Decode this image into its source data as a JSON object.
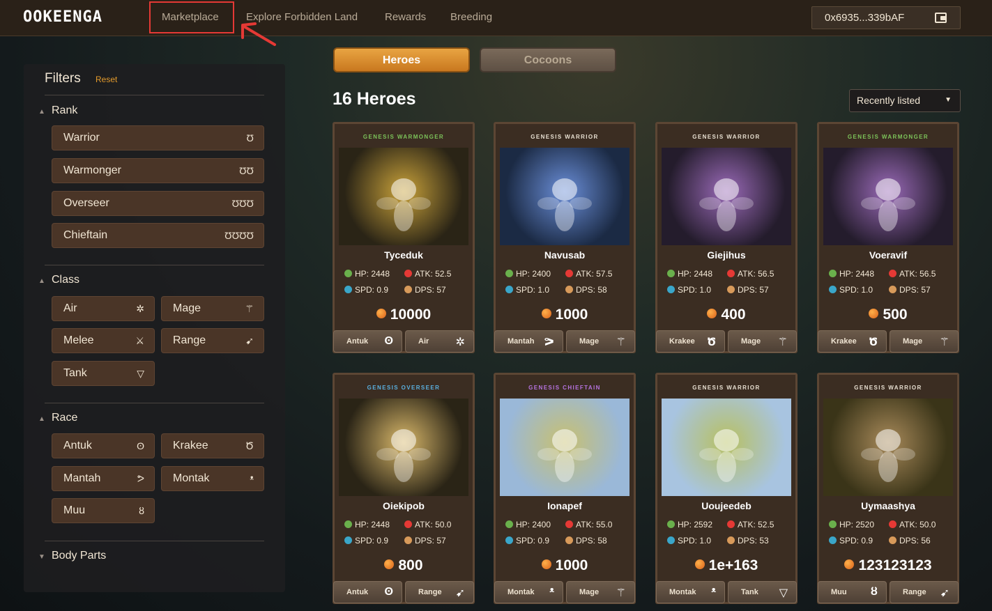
{
  "topbar": {
    "logo": "OOKEENGA",
    "nav": [
      "Marketplace",
      "Explore Forbidden Land",
      "Rewards",
      "Breeding"
    ],
    "wallet": "0x6935...339bAF"
  },
  "filters": {
    "title": "Filters",
    "reset": "Reset",
    "rank": {
      "title": "Rank",
      "items": [
        {
          "label": "Warrior",
          "icon": "Ʊ"
        },
        {
          "label": "Warmonger",
          "icon": "ƱƱ"
        },
        {
          "label": "Overseer",
          "icon": "ƱƱƱ"
        },
        {
          "label": "Chieftain",
          "icon": "ƱƱƱƱ"
        }
      ]
    },
    "class": {
      "title": "Class",
      "items": [
        {
          "label": "Air",
          "icon": "✲"
        },
        {
          "label": "Mage",
          "icon": "⚚"
        },
        {
          "label": "Melee",
          "icon": "⚔"
        },
        {
          "label": "Range",
          "icon": "➹"
        },
        {
          "label": "Tank",
          "icon": "▽"
        }
      ]
    },
    "race": {
      "title": "Race",
      "items": [
        {
          "label": "Antuk",
          "icon": "ʘ"
        },
        {
          "label": "Krakee",
          "icon": "Ծ"
        },
        {
          "label": "Mantah",
          "icon": "ᕗ"
        },
        {
          "label": "Montak",
          "icon": "ᵜ"
        },
        {
          "label": "Muu",
          "icon": "ȣ"
        }
      ]
    },
    "body_parts": {
      "title": "Body Parts"
    }
  },
  "tabs": {
    "heroes": "Heroes",
    "cocoons": "Cocoons"
  },
  "heroes_count": "16 Heroes",
  "sort": {
    "selected": "Recently listed"
  },
  "cards": [
    {
      "label": "GENESIS WARMONGER",
      "label_color": "#7cc35a",
      "name": "Tyceduk",
      "hp": "HP: 2448",
      "atk": "ATK: 52.5",
      "spd": "SPD: 0.9",
      "dps": "DPS: 57",
      "price": "10000",
      "race": "Antuk",
      "race_icon": "ʘ",
      "cls": "Air",
      "cls_icon": "✲",
      "art": [
        "#2a2416",
        "#c9a23a"
      ]
    },
    {
      "label": "GENESIS WARRIOR",
      "label_color": "#e8e0d2",
      "name": "Navusab",
      "hp": "HP: 2400",
      "atk": "ATK: 57.5",
      "spd": "SPD: 1.0",
      "dps": "DPS: 58",
      "price": "1000",
      "race": "Mantah",
      "race_icon": "ᕗ",
      "cls": "Mage",
      "cls_icon": "⚚",
      "art": [
        "#1b2a44",
        "#6a8ed8"
      ]
    },
    {
      "label": "GENESIS WARRIOR",
      "label_color": "#e8e0d2",
      "name": "Giejihus",
      "hp": "HP: 2448",
      "atk": "ATK: 56.5",
      "spd": "SPD: 1.0",
      "dps": "DPS: 57",
      "price": "400",
      "race": "Krakee",
      "race_icon": "Ծ",
      "cls": "Mage",
      "cls_icon": "⚚",
      "art": [
        "#241c2c",
        "#9a6ab8"
      ]
    },
    {
      "label": "GENESIS WARMONGER",
      "label_color": "#7cc35a",
      "name": "Voeravif",
      "hp": "HP: 2448",
      "atk": "ATK: 56.5",
      "spd": "SPD: 1.0",
      "dps": "DPS: 57",
      "price": "500",
      "race": "Krakee",
      "race_icon": "Ծ",
      "cls": "Mage",
      "cls_icon": "⚚",
      "art": [
        "#241c2c",
        "#9a6ab8"
      ]
    },
    {
      "label": "GENESIS OVERSEER",
      "label_color": "#5ab0e0",
      "name": "Oiekipob",
      "hp": "HP: 2448",
      "atk": "ATK: 50.0",
      "spd": "SPD: 0.9",
      "dps": "DPS: 57",
      "price": "800",
      "race": "Antuk",
      "race_icon": "ʘ",
      "cls": "Range",
      "cls_icon": "➹",
      "art": [
        "#2a2416",
        "#d9b86a"
      ]
    },
    {
      "label": "GENESIS CHIEFTAIN",
      "label_color": "#b673e0",
      "name": "Ionapef",
      "hp": "HP: 2400",
      "atk": "ATK: 55.0",
      "spd": "SPD: 0.9",
      "dps": "DPS: 58",
      "price": "1000",
      "race": "Montak",
      "race_icon": "ᵜ",
      "cls": "Mage",
      "cls_icon": "⚚",
      "art": [
        "#9ab8d8",
        "#c8c070"
      ]
    },
    {
      "label": "GENESIS WARRIOR",
      "label_color": "#e8e0d2",
      "name": "Uoujeedeb",
      "hp": "HP: 2592",
      "atk": "ATK: 52.5",
      "spd": "SPD: 1.0",
      "dps": "DPS: 53",
      "price": "1e+163",
      "race": "Montak",
      "race_icon": "ᵜ",
      "cls": "Tank",
      "cls_icon": "▽",
      "art": [
        "#a8c4e0",
        "#b8c060"
      ]
    },
    {
      "label": "GENESIS WARRIOR",
      "label_color": "#e8e0d2",
      "name": "Uymaashya",
      "hp": "HP: 2520",
      "atk": "ATK: 50.0",
      "spd": "SPD: 0.9",
      "dps": "DPS: 56",
      "price": "123123123",
      "race": "Muu",
      "race_icon": "ȣ",
      "cls": "Range",
      "cls_icon": "➹",
      "art": [
        "#3a3418",
        "#a88a5a"
      ]
    }
  ],
  "colors": {
    "accent": "#e29a2c",
    "hp": "#6ab04c",
    "atk": "#e53935",
    "spd": "#3aa6c9",
    "dps": "#d89a5a",
    "highlight": "#e53935"
  }
}
